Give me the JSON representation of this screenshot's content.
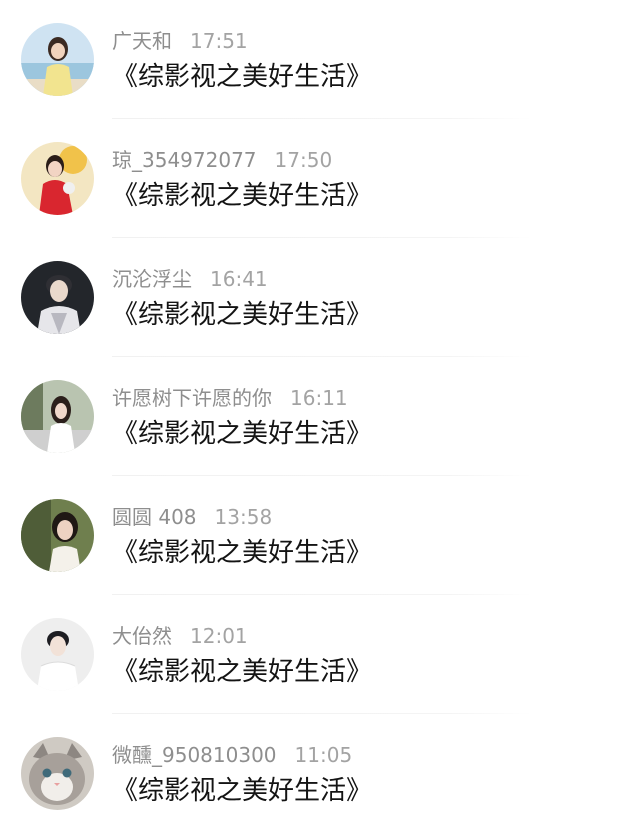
{
  "comments": [
    {
      "name": "广天和",
      "time": "17:51",
      "text": "《综影视之美好生活》",
      "avatar": "avatar-beach-girl"
    },
    {
      "name": "琼_354972077",
      "time": "17:50",
      "text": "《综影视之美好生活》",
      "avatar": "avatar-red-dress-woman"
    },
    {
      "name": "沉沦浮尘",
      "time": "16:41",
      "text": "《综影视之美好生活》",
      "avatar": "avatar-young-man"
    },
    {
      "name": "许愿树下许愿的你",
      "time": "16:11",
      "text": "《综影视之美好生活》",
      "avatar": "avatar-street-girl"
    },
    {
      "name": "圆圆 408",
      "time": "13:58",
      "text": "《综影视之美好生活》",
      "avatar": "avatar-forest-woman"
    },
    {
      "name": "大佁然",
      "time": "12:01",
      "text": "《综影视之美好生活》",
      "avatar": "avatar-white-shirt-man"
    },
    {
      "name": "微醺_950810300",
      "time": "11:05",
      "text": "《综影视之美好生活》",
      "avatar": "avatar-cat"
    }
  ]
}
